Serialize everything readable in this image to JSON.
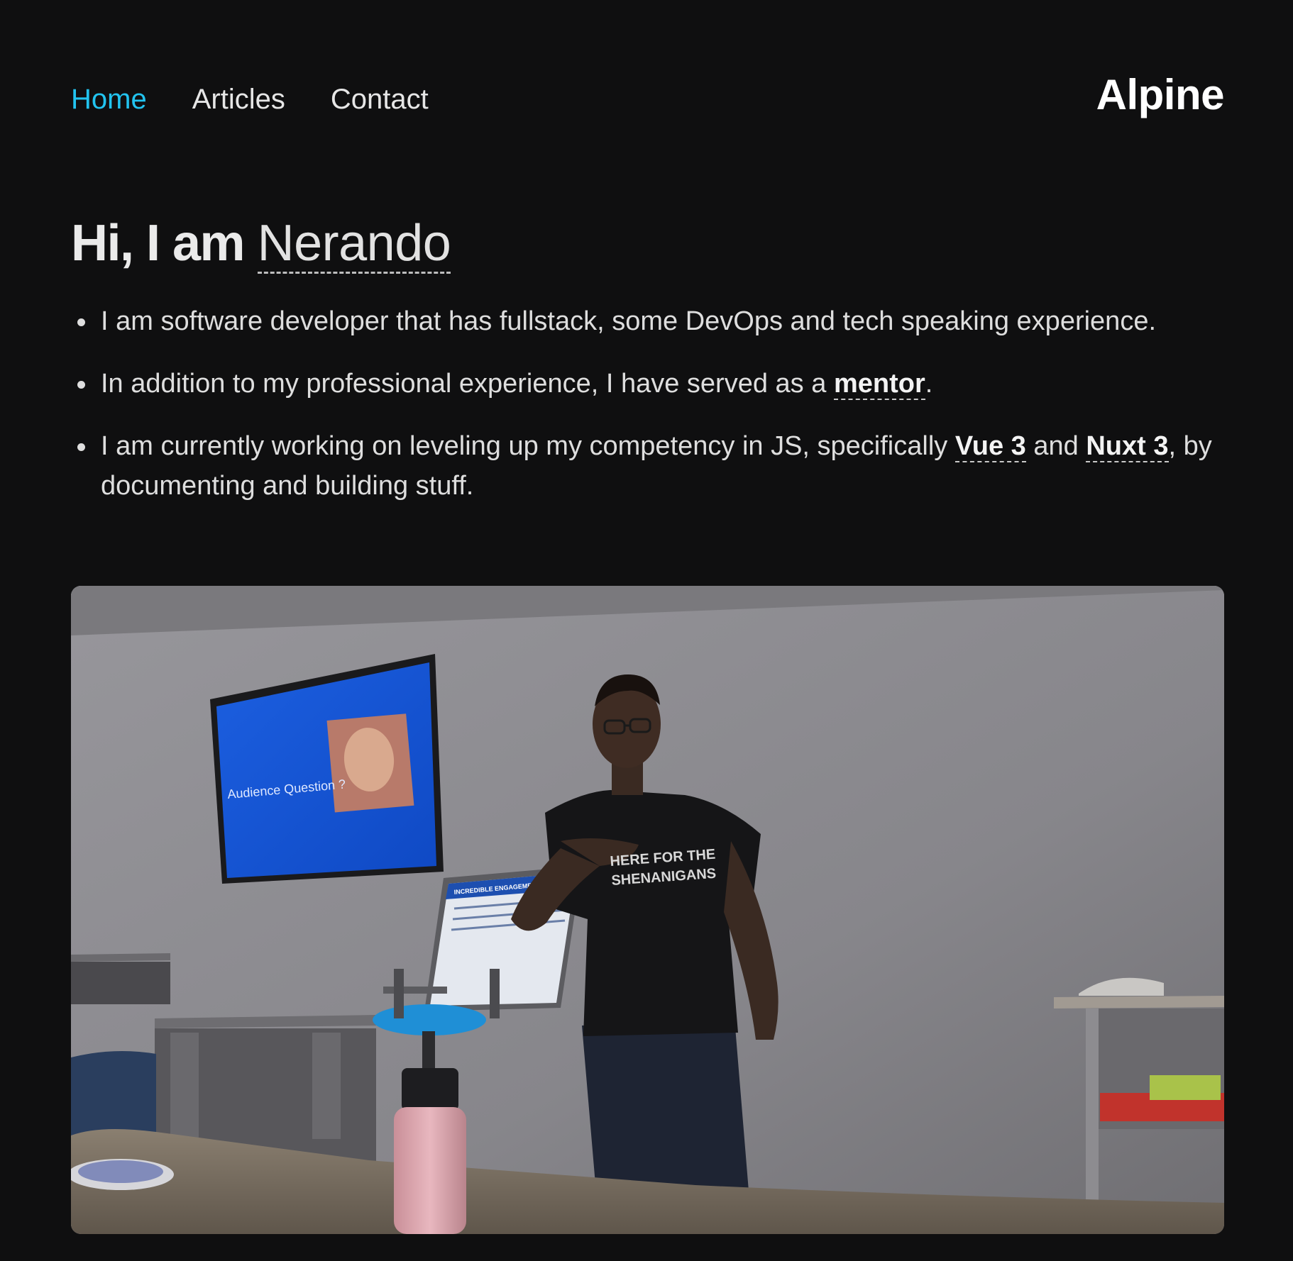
{
  "nav": {
    "items": [
      {
        "label": "Home",
        "active": true
      },
      {
        "label": "Articles",
        "active": false
      },
      {
        "label": "Contact",
        "active": false
      }
    ],
    "brand": "Alpine"
  },
  "hero": {
    "greeting": "Hi, I am",
    "name": "Nerando"
  },
  "facts": {
    "item1": "I am software developer that has fullstack, some DevOps and tech speaking experience.",
    "item2_prefix": "In addition to my professional experience, I have served as a",
    "item2_link": "mentor",
    "item2_suffix": ".",
    "item3_prefix": "I am currently working on leveling up my competency in JS, specifically",
    "item3_link1": "Vue 3",
    "item3_and": "and",
    "item3_link2": "Nuxt 3",
    "item3_suffix": ", by documenting and building stuff."
  },
  "photo": {
    "screen_text": "Audience Question ?",
    "poster_text": "INCREDIBLE ENGAGEMENT",
    "shirt_text_line1": "HERE FOR THE",
    "shirt_text_line2": "SHENANIGANS"
  },
  "colors": {
    "background": "#0f0f10",
    "accent": "#22c3ef",
    "text": "#e6e6e6"
  }
}
